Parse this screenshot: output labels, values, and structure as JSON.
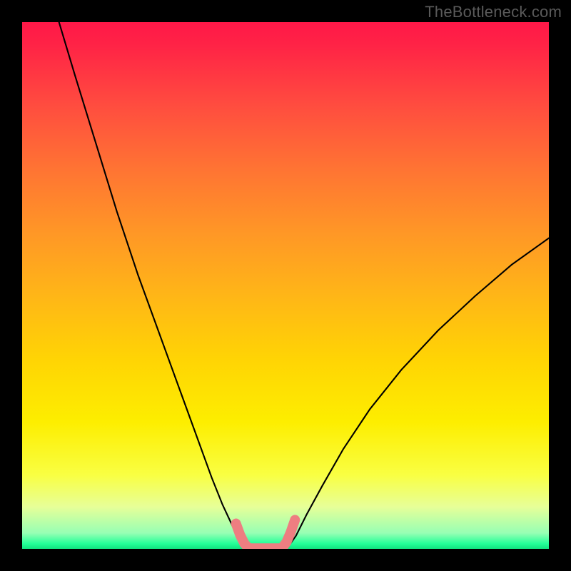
{
  "watermark": "TheBottleneck.com",
  "chart_data": {
    "type": "line",
    "title": "",
    "xlabel": "",
    "ylabel": "",
    "xlim": [
      0,
      100
    ],
    "ylim": [
      0,
      100
    ],
    "gradient_colors": {
      "top": "#ff1848",
      "mid_upper": "#ff9726",
      "mid": "#ffd404",
      "mid_lower": "#fdee00",
      "bottom": "#11e27f"
    },
    "series": [
      {
        "name": "black-curve-left",
        "color": "#000000",
        "stroke_width": 2.1,
        "x": [
          7.0,
          10,
          14,
          18,
          22,
          26,
          30,
          34,
          36,
          38,
          40,
          41.5,
          42.3
        ],
        "y": [
          100,
          90,
          77,
          64,
          52,
          41,
          30,
          19,
          13.5,
          8.5,
          4.2,
          1.6,
          0.4
        ]
      },
      {
        "name": "black-curve-right",
        "color": "#000000",
        "stroke_width": 2.1,
        "x": [
          50.5,
          52,
          54,
          57,
          61,
          66,
          72,
          79,
          86,
          93,
          100
        ],
        "y": [
          0.4,
          2.5,
          6.5,
          12,
          19,
          26.5,
          34,
          41.5,
          48,
          54,
          59
        ]
      },
      {
        "name": "pink-marker-left",
        "color": "#ee7e81",
        "stroke_width": 14,
        "x": [
          40.6,
          41.4,
          42.2,
          43.0
        ],
        "y": [
          4.8,
          2.6,
          1.0,
          0.1
        ]
      },
      {
        "name": "pink-marker-bottom",
        "color": "#ee7e81",
        "stroke_width": 14,
        "x": [
          43.0,
          45.0,
          47.0,
          49.3
        ],
        "y": [
          0.1,
          0.1,
          0.1,
          0.1
        ]
      },
      {
        "name": "pink-marker-right",
        "color": "#ee7e81",
        "stroke_width": 14,
        "x": [
          49.3,
          50.2,
          51.0,
          51.8
        ],
        "y": [
          0.1,
          1.3,
          3.2,
          5.5
        ]
      }
    ]
  }
}
